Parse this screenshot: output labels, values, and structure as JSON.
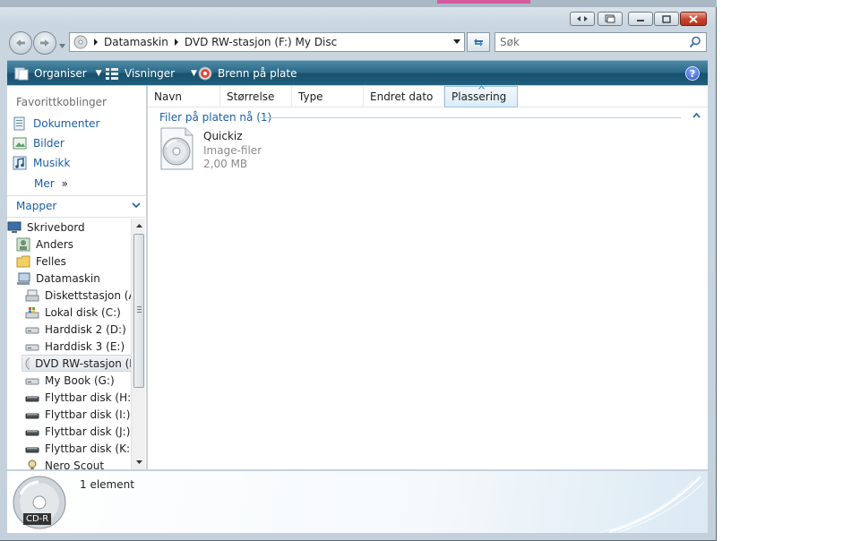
{
  "window": {
    "title": "My Disc"
  },
  "nav": {
    "breadcrumbs": [
      "Datamaskin",
      "DVD RW-stasjon (F:) My Disc"
    ],
    "search_placeholder": "Søk"
  },
  "toolbar": {
    "organize_label": "Organiser",
    "views_label": "Visninger",
    "burn_label": "Brenn på plate",
    "help_label": "?"
  },
  "favorites": {
    "title": "Favorittkoblinger",
    "items": [
      {
        "label": "Dokumenter",
        "icon": "documents-icon"
      },
      {
        "label": "Bilder",
        "icon": "pictures-icon"
      },
      {
        "label": "Musikk",
        "icon": "music-icon"
      }
    ],
    "more_label": "Mer",
    "more_glyph": "»"
  },
  "folders": {
    "title": "Mapper",
    "tree": [
      {
        "label": "Skrivebord",
        "icon": "desktop-icon",
        "level": 0
      },
      {
        "label": "Anders",
        "icon": "user-folder-icon",
        "level": 1
      },
      {
        "label": "Felles",
        "icon": "folder-icon",
        "level": 1
      },
      {
        "label": "Datamaskin",
        "icon": "computer-icon",
        "level": 1
      },
      {
        "label": "Diskettstasjon (A:)",
        "icon": "floppy-icon",
        "level": 2
      },
      {
        "label": "Lokal disk (C:)",
        "icon": "system-drive-icon",
        "level": 2
      },
      {
        "label": "Harddisk 2 (D:)",
        "icon": "hard-drive-icon",
        "level": 2
      },
      {
        "label": "Harddisk 3 (E:)",
        "icon": "hard-drive-icon",
        "level": 2
      },
      {
        "label": "DVD RW-stasjon (F:)",
        "icon": "dvd-drive-icon",
        "level": 2,
        "selected": true
      },
      {
        "label": "My Book (G:)",
        "icon": "hard-drive-icon",
        "level": 2
      },
      {
        "label": "Flyttbar disk (H:)",
        "icon": "removable-drive-icon",
        "level": 2
      },
      {
        "label": "Flyttbar disk (I:)",
        "icon": "removable-drive-icon",
        "level": 2
      },
      {
        "label": "Flyttbar disk (J:)",
        "icon": "removable-drive-icon",
        "level": 2
      },
      {
        "label": "Flyttbar disk (K:)",
        "icon": "removable-drive-icon",
        "level": 2
      },
      {
        "label": "Nero Scout",
        "icon": "nero-scout-icon",
        "level": 2
      }
    ]
  },
  "columns": [
    "Navn",
    "Størrelse",
    "Type",
    "Endret dato",
    "Plassering"
  ],
  "group": {
    "label": "Filer på platen nå (1)"
  },
  "files": [
    {
      "name": "Quickiz",
      "type": "Image-filer",
      "size": "2,00 MB",
      "icon": "disc-image-icon"
    }
  ],
  "details": {
    "count": "1 element",
    "badge": "CD-R"
  }
}
